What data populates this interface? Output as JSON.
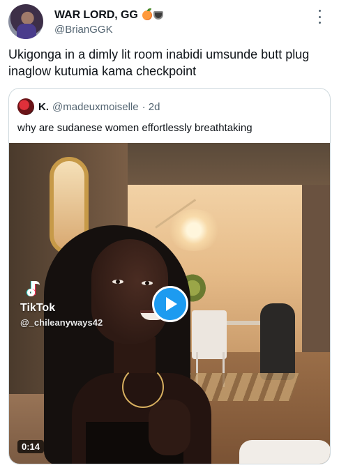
{
  "tweet": {
    "author_name": "WAR LORD, GG",
    "author_handle": "@BrianGGK",
    "name_emojis": [
      "peach-emoji",
      "coffee-emoji"
    ],
    "text": "Ukigonga in a dimly lit room inabidi umsunde butt plug inaglow kutumia kama checkpoint"
  },
  "quote": {
    "author_name": "K.",
    "author_handle": "@madeuxmoiselle",
    "time": "· 2d",
    "text": "why are sudanese women effortlessly breathtaking",
    "media": {
      "watermark_brand": "TikTok",
      "watermark_user": "@_chileanyways42",
      "duration": "0:14",
      "play_icon": "play-icon"
    }
  },
  "colors": {
    "accent": "#1d9bf0",
    "secondary_text": "#536471",
    "border": "#cfd9de"
  }
}
